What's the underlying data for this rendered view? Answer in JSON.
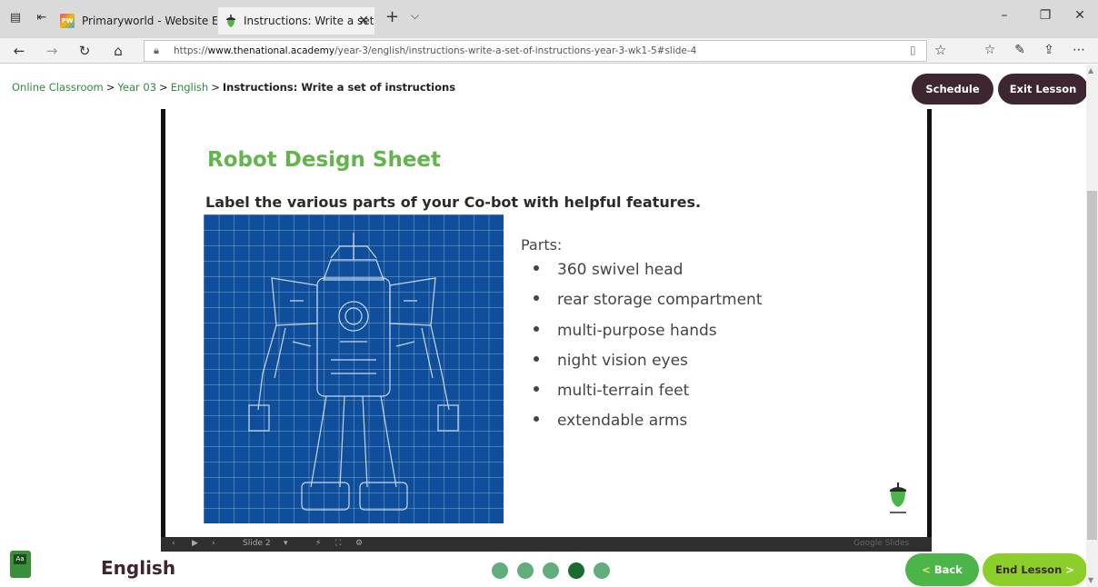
{
  "browser": {
    "tabs": [
      {
        "title": "Primaryworld - Website Edit",
        "favicon": "pw-favicon",
        "favicon_label": "PW",
        "active": false
      },
      {
        "title": "Instructions: Write a set",
        "favicon": "acorn-favicon",
        "active": true
      }
    ],
    "new_tab": "+",
    "tab_menu": "⌵",
    "window_controls": {
      "minimize": "–",
      "restore": "❐",
      "close": "✕"
    },
    "url_prefix": "https://",
    "url_domain": "www.thenational.academy",
    "url_path": "/year-3/english/instructions-write-a-set-of-instructions-year-3-wk1-5#slide-4"
  },
  "breadcrumb": {
    "items": [
      "Online Classroom",
      "Year 03",
      "English"
    ],
    "current": "Instructions: Write a set of instructions",
    "separator": ">"
  },
  "header_buttons": {
    "schedule": "Schedule",
    "exit": "Exit Lesson"
  },
  "slide": {
    "title": "Robot Design Sheet",
    "instruction": "Label the various parts of your Co-bot with helpful features.",
    "parts_heading": "Parts:",
    "parts": [
      "360 swivel head",
      "rear storage compartment",
      "multi-purpose hands",
      "night vision eyes",
      "multi-terrain feet",
      "extendable arms"
    ]
  },
  "slide_controls": {
    "slide_label": "Slide 2",
    "branding": "Google Slides"
  },
  "footer": {
    "subject": "English",
    "subject_icon_label": "Aa",
    "progress": {
      "total": 5,
      "current": 4
    },
    "back": "Back",
    "end": "End Lesson",
    "chevron_left": "<",
    "chevron_right": ">"
  },
  "colors": {
    "accent_green": "#62b54a",
    "dark_plum": "#3d2531",
    "blueprint_blue": "#0e4e9a",
    "link_green": "#2d8a3e"
  }
}
